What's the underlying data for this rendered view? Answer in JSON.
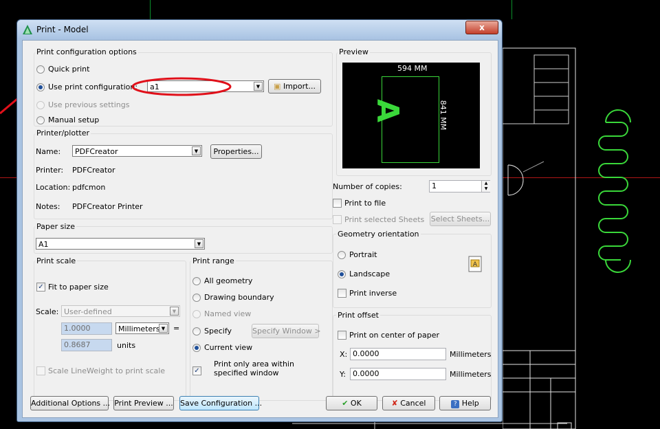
{
  "window": {
    "title": "Print - Model",
    "close": "x"
  },
  "config": {
    "group": "Print configuration options",
    "quick": "Quick print",
    "use_config": "Use print configuration:",
    "use_config_value": "a1",
    "import": "Import...",
    "previous": "Use previous settings",
    "manual": "Manual setup",
    "selected": "use_config"
  },
  "printer": {
    "group": "Printer/plotter",
    "name_label": "Name:",
    "name_value": "PDFCreator",
    "properties": "Properties...",
    "printer_label": "Printer:",
    "printer_value": "PDFCreator",
    "location_label": "Location:",
    "location_value": "pdfcmon",
    "notes_label": "Notes:",
    "notes_value": "PDFCreator Printer"
  },
  "paper": {
    "group": "Paper size",
    "value": "A1"
  },
  "scale": {
    "group": "Print scale",
    "fit": "Fit to paper size",
    "fit_checked": true,
    "scale_label": "Scale:",
    "scale_value": "User-defined",
    "value1": "1.0000",
    "unit1": "Millimeters",
    "equals": "=",
    "value2": "0.8687",
    "unit2": "units",
    "lineweight": "Scale LineWeight to print scale"
  },
  "range": {
    "group": "Print range",
    "all": "All geometry",
    "boundary": "Drawing boundary",
    "named": "Named view",
    "specify": "Specify",
    "specify_btn": "Specify Window >",
    "current": "Current view",
    "selected": "current",
    "only_area": "Print only area within specified window",
    "only_area_checked": true
  },
  "preview": {
    "group": "Preview",
    "width_label": "594 MM",
    "height_label": "841 MM",
    "glyph": "A"
  },
  "copies": {
    "label": "Number of copies:",
    "value": "1"
  },
  "print_to_file": "Print to file",
  "selected_sheets": "Print selected Sheets",
  "select_sheets_btn": "Select Sheets...",
  "orientation": {
    "group": "Geometry orientation",
    "portrait": "Portrait",
    "landscape": "Landscape",
    "inverse": "Print inverse",
    "selected": "landscape"
  },
  "offset": {
    "group": "Print offset",
    "center": "Print on center of paper",
    "x_label": "X:",
    "x_value": "0.0000",
    "x_unit": "Millimeters",
    "y_label": "Y:",
    "y_value": "0.0000",
    "y_unit": "Millimeters"
  },
  "buttons": {
    "additional": "Additional Options ...",
    "preview": "Print Preview ...",
    "save": "Save Configuration ...",
    "ok": "OK",
    "cancel": "Cancel",
    "help": "Help"
  },
  "colors": {
    "annotation": "#e0101a",
    "cad_green": "#3ad83a",
    "accent": "#1f4f99"
  }
}
